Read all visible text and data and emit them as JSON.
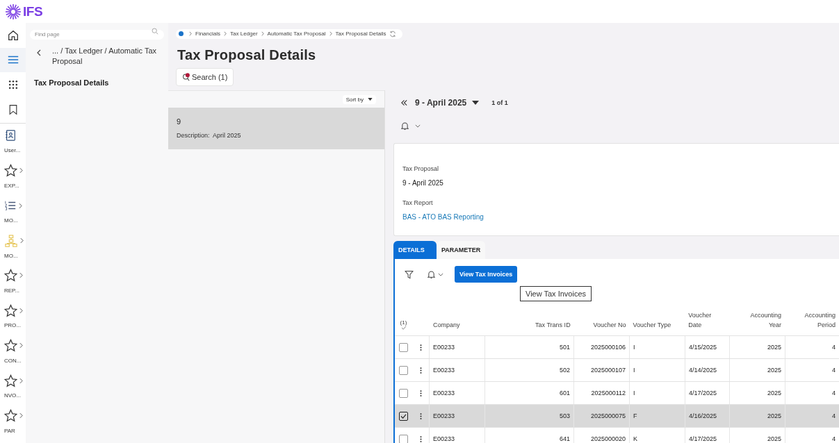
{
  "logo": {
    "text": "IFS"
  },
  "rail": {
    "top_items": [
      {
        "selected": false
      },
      {
        "selected": true
      },
      {
        "selected": false
      },
      {
        "selected": false
      }
    ],
    "items": [
      {
        "label": "User...",
        "has_submenu": false
      },
      {
        "label": "EXP...",
        "has_submenu": true
      },
      {
        "label": "MO...",
        "has_submenu": true
      },
      {
        "label": "MO...",
        "has_submenu": true
      },
      {
        "label": "REP...",
        "has_submenu": true
      },
      {
        "label": "PRO...",
        "has_submenu": true
      },
      {
        "label": "CON...",
        "has_submenu": true
      },
      {
        "label": "NVO...",
        "has_submenu": true
      },
      {
        "label": "PAR",
        "has_submenu": true
      }
    ]
  },
  "nav_panel": {
    "search": {
      "placeholder": "Find page"
    },
    "parent_path": "... / Tax Ledger / Automatic Tax Proposal",
    "current": "Tax Proposal Details"
  },
  "breadcrumb": [
    "Financials",
    "Tax Ledger",
    "Automatic Tax Proposal",
    "Tax Proposal Details"
  ],
  "page_title": "Tax Proposal Details",
  "search_button": {
    "label": "Search (1)"
  },
  "list": {
    "sort_label": "Sort by",
    "items": [
      {
        "title": "9",
        "description_label": "Description:",
        "description": "April 2025",
        "selected": true
      }
    ]
  },
  "record_nav": {
    "record": "9 - April 2025",
    "counter": "1 of 1"
  },
  "header_card": {
    "fields": [
      {
        "label": "Tax Proposal",
        "value": "9 - April 2025",
        "kind": "text"
      },
      {
        "label": "Tax Report",
        "value": "BAS - ATO BAS Reporting",
        "kind": "link"
      }
    ]
  },
  "tabs": [
    {
      "label": "DETAILS",
      "selected": true
    },
    {
      "label": "PARAMETER",
      "selected": false
    }
  ],
  "toolbar": {
    "button": "View Tax Invoices",
    "tooltip": "View Tax Invoices"
  },
  "table": {
    "selected_count": "(1)",
    "columns": [
      {
        "label": "Company",
        "kind": "text"
      },
      {
        "label": "Tax Trans ID",
        "kind": "number"
      },
      {
        "label": "Voucher No",
        "kind": "number"
      },
      {
        "label": "Voucher Type",
        "kind": "text"
      },
      {
        "label": "Voucher Date",
        "kind": "text"
      },
      {
        "label": "Accounting Year",
        "kind": "number"
      },
      {
        "label": "Accounting Period",
        "kind": "number"
      }
    ],
    "rows": [
      {
        "selected": false,
        "cells": [
          "E00233",
          "501",
          "2025000106",
          "I",
          "4/15/2025",
          "2025",
          "4"
        ]
      },
      {
        "selected": false,
        "cells": [
          "E00233",
          "502",
          "2025000107",
          "I",
          "4/14/2025",
          "2025",
          "4"
        ]
      },
      {
        "selected": false,
        "cells": [
          "E00233",
          "601",
          "2025000112",
          "I",
          "4/17/2025",
          "2025",
          "4"
        ]
      },
      {
        "selected": true,
        "cells": [
          "E00233",
          "503",
          "2025000075",
          "F",
          "4/16/2025",
          "2025",
          "4"
        ]
      },
      {
        "selected": false,
        "cells": [
          "E00233",
          "641",
          "2025000020",
          "K",
          "4/17/2025",
          "2025",
          "4"
        ]
      }
    ]
  }
}
